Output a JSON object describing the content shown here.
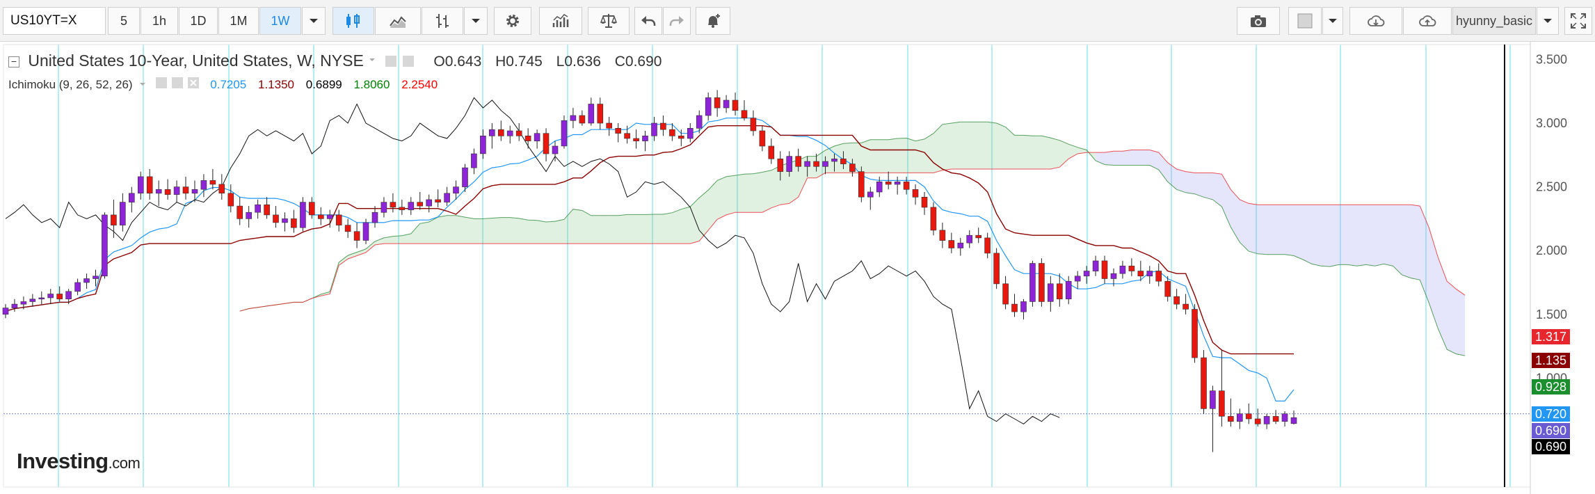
{
  "toolbar": {
    "symbol": "US10YT=X",
    "intervals": [
      "5",
      "1h",
      "1D",
      "1M",
      "1W"
    ],
    "active_interval": "1W",
    "username": "hyunny_basic"
  },
  "legend": {
    "title": "United States 10-Year, United States, W, NYSE",
    "open": "O0.643",
    "high": "H0.745",
    "low": "L0.636",
    "close": "C0.690",
    "indicator": "Ichimoku (9, 26, 52, 26)",
    "indicator_values": [
      {
        "text": "0.7205",
        "color": "#2196f3"
      },
      {
        "text": "1.1350",
        "color": "#8b0000"
      },
      {
        "text": "0.6899",
        "color": "#000000"
      },
      {
        "text": "1.8060",
        "color": "#008000"
      },
      {
        "text": "2.2540",
        "color": "#ff0000"
      }
    ]
  },
  "logo": {
    "brand": "Investing",
    "suffix": ".com"
  },
  "chart_data": {
    "type": "candlestick",
    "yaxis_ticks": [
      3.5,
      3.0,
      2.5,
      2.0,
      1.5,
      1.0
    ],
    "yaxis_labels": [
      "3.500",
      "3.000",
      "2.500",
      "2.000",
      "1.500",
      "1.000"
    ],
    "ylim": [
      0.05,
      3.6
    ],
    "price_labels": [
      {
        "text": "1.317",
        "value": 1.317,
        "color": "#e8262d"
      },
      {
        "text": "1.135",
        "value": 1.135,
        "color": "#8b0000"
      },
      {
        "text": "0.928",
        "value": 0.928,
        "color": "#1b8e2d"
      },
      {
        "text": "0.720",
        "value": 0.72,
        "color": "#2196f3"
      },
      {
        "text": "0.690",
        "value": 0.69,
        "color": "#6b5bd3"
      },
      {
        "text": "0.690",
        "value": 0.69,
        "color": "#000000"
      }
    ],
    "candles": [
      [
        1.5,
        1.58,
        1.47,
        1.55
      ],
      [
        1.55,
        1.62,
        1.52,
        1.58
      ],
      [
        1.58,
        1.64,
        1.54,
        1.6
      ],
      [
        1.6,
        1.66,
        1.56,
        1.62
      ],
      [
        1.62,
        1.68,
        1.58,
        1.63
      ],
      [
        1.63,
        1.7,
        1.58,
        1.66
      ],
      [
        1.66,
        1.72,
        1.6,
        1.62
      ],
      [
        1.62,
        1.7,
        1.58,
        1.68
      ],
      [
        1.68,
        1.78,
        1.65,
        1.75
      ],
      [
        1.75,
        1.82,
        1.7,
        1.78
      ],
      [
        1.78,
        1.85,
        1.72,
        1.8
      ],
      [
        1.8,
        2.3,
        1.78,
        2.28
      ],
      [
        2.28,
        2.4,
        2.1,
        2.2
      ],
      [
        2.2,
        2.45,
        2.15,
        2.38
      ],
      [
        2.38,
        2.5,
        2.3,
        2.45
      ],
      [
        2.45,
        2.62,
        2.4,
        2.58
      ],
      [
        2.58,
        2.64,
        2.4,
        2.45
      ],
      [
        2.45,
        2.55,
        2.35,
        2.48
      ],
      [
        2.48,
        2.56,
        2.4,
        2.44
      ],
      [
        2.44,
        2.55,
        2.38,
        2.5
      ],
      [
        2.5,
        2.58,
        2.4,
        2.45
      ],
      [
        2.45,
        2.55,
        2.38,
        2.48
      ],
      [
        2.48,
        2.6,
        2.42,
        2.55
      ],
      [
        2.55,
        2.64,
        2.48,
        2.52
      ],
      [
        2.52,
        2.6,
        2.4,
        2.45
      ],
      [
        2.45,
        2.52,
        2.3,
        2.35
      ],
      [
        2.35,
        2.42,
        2.2,
        2.25
      ],
      [
        2.25,
        2.35,
        2.18,
        2.3
      ],
      [
        2.3,
        2.4,
        2.25,
        2.36
      ],
      [
        2.36,
        2.42,
        2.25,
        2.28
      ],
      [
        2.28,
        2.35,
        2.18,
        2.22
      ],
      [
        2.22,
        2.3,
        2.15,
        2.25
      ],
      [
        2.25,
        2.32,
        2.14,
        2.18
      ],
      [
        2.18,
        2.42,
        2.15,
        2.38
      ],
      [
        2.38,
        2.42,
        2.25,
        2.28
      ],
      [
        2.28,
        2.34,
        2.2,
        2.25
      ],
      [
        2.25,
        2.32,
        2.18,
        2.28
      ],
      [
        2.28,
        2.32,
        2.15,
        2.2
      ],
      [
        2.2,
        2.25,
        2.1,
        2.15
      ],
      [
        2.15,
        2.22,
        2.02,
        2.08
      ],
      [
        2.08,
        2.25,
        2.05,
        2.22
      ],
      [
        2.22,
        2.35,
        2.18,
        2.3
      ],
      [
        2.3,
        2.42,
        2.26,
        2.38
      ],
      [
        2.38,
        2.45,
        2.3,
        2.34
      ],
      [
        2.34,
        2.4,
        2.28,
        2.32
      ],
      [
        2.32,
        2.42,
        2.28,
        2.38
      ],
      [
        2.38,
        2.46,
        2.32,
        2.35
      ],
      [
        2.35,
        2.44,
        2.3,
        2.4
      ],
      [
        2.4,
        2.48,
        2.34,
        2.38
      ],
      [
        2.38,
        2.5,
        2.35,
        2.45
      ],
      [
        2.45,
        2.55,
        2.4,
        2.5
      ],
      [
        2.5,
        2.68,
        2.46,
        2.65
      ],
      [
        2.65,
        2.8,
        2.6,
        2.76
      ],
      [
        2.76,
        2.95,
        2.72,
        2.9
      ],
      [
        2.9,
        3.0,
        2.8,
        2.95
      ],
      [
        2.95,
        3.02,
        2.86,
        2.9
      ],
      [
        2.9,
        2.98,
        2.84,
        2.94
      ],
      [
        2.94,
        3.0,
        2.86,
        2.9
      ],
      [
        2.9,
        2.96,
        2.8,
        2.86
      ],
      [
        2.86,
        2.95,
        2.8,
        2.92
      ],
      [
        2.92,
        2.96,
        2.7,
        2.76
      ],
      [
        2.76,
        2.86,
        2.7,
        2.82
      ],
      [
        2.82,
        3.06,
        2.8,
        3.02
      ],
      [
        3.02,
        3.12,
        2.96,
        3.06
      ],
      [
        3.06,
        3.1,
        2.98,
        3.0
      ],
      [
        3.0,
        3.2,
        2.98,
        3.15
      ],
      [
        3.15,
        3.2,
        2.95,
        3.0
      ],
      [
        3.0,
        3.05,
        2.9,
        2.96
      ],
      [
        2.96,
        3.0,
        2.85,
        2.92
      ],
      [
        2.92,
        2.98,
        2.84,
        2.88
      ],
      [
        2.88,
        2.95,
        2.8,
        2.86
      ],
      [
        2.86,
        2.94,
        2.78,
        2.9
      ],
      [
        2.9,
        3.05,
        2.86,
        3.0
      ],
      [
        3.0,
        3.06,
        2.9,
        2.95
      ],
      [
        2.95,
        3.0,
        2.86,
        2.9
      ],
      [
        2.9,
        2.95,
        2.82,
        2.88
      ],
      [
        2.88,
        3.0,
        2.85,
        2.96
      ],
      [
        2.96,
        3.1,
        2.92,
        3.06
      ],
      [
        3.06,
        3.24,
        3.02,
        3.2
      ],
      [
        3.2,
        3.26,
        3.05,
        3.12
      ],
      [
        3.12,
        3.22,
        3.08,
        3.18
      ],
      [
        3.18,
        3.24,
        3.06,
        3.1
      ],
      [
        3.1,
        3.18,
        3.02,
        3.04
      ],
      [
        3.04,
        3.1,
        2.9,
        2.94
      ],
      [
        2.94,
        2.98,
        2.78,
        2.82
      ],
      [
        2.82,
        2.88,
        2.68,
        2.72
      ],
      [
        2.72,
        2.78,
        2.55,
        2.62
      ],
      [
        2.62,
        2.78,
        2.58,
        2.74
      ],
      [
        2.74,
        2.8,
        2.62,
        2.66
      ],
      [
        2.66,
        2.74,
        2.58,
        2.7
      ],
      [
        2.7,
        2.76,
        2.62,
        2.66
      ],
      [
        2.66,
        2.74,
        2.6,
        2.7
      ],
      [
        2.7,
        2.76,
        2.62,
        2.72
      ],
      [
        2.72,
        2.78,
        2.64,
        2.68
      ],
      [
        2.68,
        2.72,
        2.58,
        2.62
      ],
      [
        2.62,
        2.66,
        2.38,
        2.42
      ],
      [
        2.42,
        2.5,
        2.32,
        2.46
      ],
      [
        2.46,
        2.58,
        2.42,
        2.54
      ],
      [
        2.54,
        2.62,
        2.48,
        2.52
      ],
      [
        2.52,
        2.58,
        2.44,
        2.54
      ],
      [
        2.54,
        2.58,
        2.44,
        2.48
      ],
      [
        2.48,
        2.52,
        2.36,
        2.42
      ],
      [
        2.42,
        2.46,
        2.28,
        2.34
      ],
      [
        2.34,
        2.38,
        2.12,
        2.16
      ],
      [
        2.16,
        2.22,
        2.02,
        2.08
      ],
      [
        2.08,
        2.14,
        1.98,
        2.02
      ],
      [
        2.02,
        2.1,
        1.96,
        2.06
      ],
      [
        2.06,
        2.16,
        2.02,
        2.12
      ],
      [
        2.12,
        2.18,
        2.06,
        2.1
      ],
      [
        2.1,
        2.14,
        1.94,
        1.98
      ],
      [
        1.98,
        2.02,
        1.7,
        1.74
      ],
      [
        1.74,
        1.8,
        1.54,
        1.58
      ],
      [
        1.58,
        1.66,
        1.48,
        1.52
      ],
      [
        1.52,
        1.62,
        1.46,
        1.6
      ],
      [
        1.6,
        1.92,
        1.56,
        1.9
      ],
      [
        1.9,
        1.94,
        1.56,
        1.6
      ],
      [
        1.6,
        1.8,
        1.52,
        1.74
      ],
      [
        1.74,
        1.82,
        1.56,
        1.62
      ],
      [
        1.62,
        1.8,
        1.58,
        1.76
      ],
      [
        1.76,
        1.84,
        1.7,
        1.8
      ],
      [
        1.8,
        1.88,
        1.74,
        1.84
      ],
      [
        1.84,
        1.96,
        1.8,
        1.92
      ],
      [
        1.92,
        1.96,
        1.74,
        1.78
      ],
      [
        1.78,
        1.86,
        1.72,
        1.82
      ],
      [
        1.82,
        1.92,
        1.78,
        1.88
      ],
      [
        1.88,
        1.94,
        1.8,
        1.84
      ],
      [
        1.84,
        1.92,
        1.76,
        1.8
      ],
      [
        1.8,
        1.88,
        1.74,
        1.84
      ],
      [
        1.84,
        1.9,
        1.72,
        1.76
      ],
      [
        1.76,
        1.8,
        1.6,
        1.64
      ],
      [
        1.64,
        1.7,
        1.54,
        1.58
      ],
      [
        1.58,
        1.66,
        1.5,
        1.54
      ],
      [
        1.54,
        1.58,
        1.12,
        1.16
      ],
      [
        1.16,
        1.22,
        0.72,
        0.76
      ],
      [
        0.76,
        0.94,
        0.42,
        0.9
      ],
      [
        0.9,
        1.22,
        0.62,
        0.7
      ],
      [
        0.7,
        0.84,
        0.62,
        0.66
      ],
      [
        0.66,
        0.76,
        0.6,
        0.72
      ],
      [
        0.72,
        0.8,
        0.64,
        0.68
      ],
      [
        0.68,
        0.76,
        0.62,
        0.64
      ],
      [
        0.64,
        0.72,
        0.6,
        0.7
      ],
      [
        0.7,
        0.75,
        0.64,
        0.66
      ],
      [
        0.66,
        0.74,
        0.62,
        0.72
      ],
      [
        0.643,
        0.745,
        0.636,
        0.69
      ]
    ]
  }
}
